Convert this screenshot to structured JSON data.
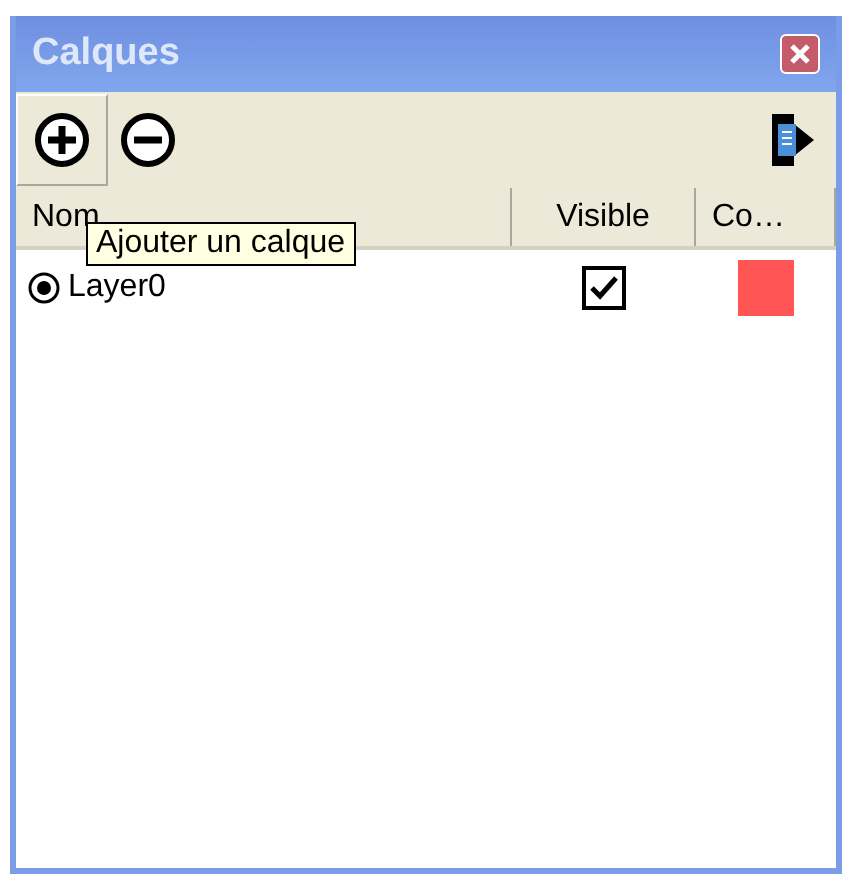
{
  "window": {
    "title": "Calques"
  },
  "toolbar": {
    "tooltip": "Ajouter un calque"
  },
  "table": {
    "columns": [
      "Nom",
      "Visible",
      "Co…"
    ],
    "rows": [
      {
        "name": "Layer0",
        "selected": true,
        "visible": true,
        "color": "#ff5555"
      }
    ]
  }
}
